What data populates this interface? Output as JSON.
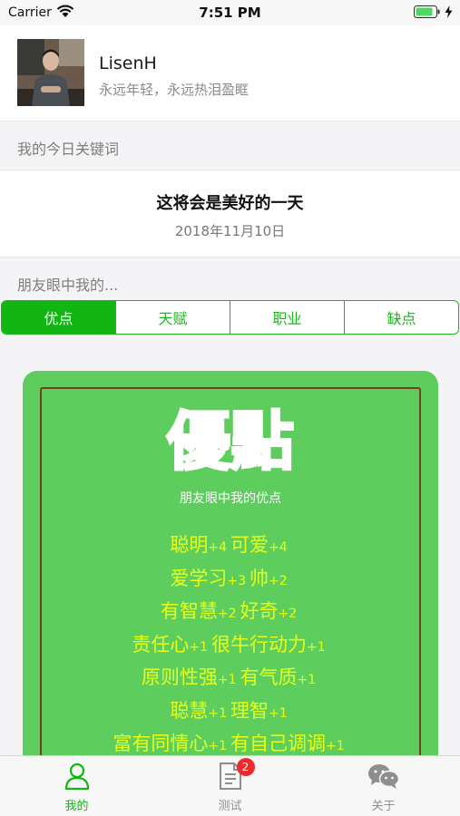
{
  "status_bar": {
    "carrier": "Carrier",
    "time": "7:51 PM"
  },
  "profile": {
    "name": "LisenH",
    "motto": "永远年轻，永远热泪盈眶"
  },
  "keyword_section": {
    "header": "我的今日关键词",
    "title": "这将会是美好的一天",
    "date": "2018年11月10日"
  },
  "friends_section": {
    "header": "朋友眼中我的..."
  },
  "tabs": [
    {
      "label": "优点",
      "active": true
    },
    {
      "label": "天赋",
      "active": false
    },
    {
      "label": "职业",
      "active": false
    },
    {
      "label": "缺点",
      "active": false
    }
  ],
  "card": {
    "logo_text": "優點",
    "subtitle": "朋友眼中我的优点",
    "lines": [
      [
        {
          "word": "聪明",
          "count": "+4"
        },
        {
          "word": "可爱",
          "count": "+4"
        }
      ],
      [
        {
          "word": "爱学习",
          "count": "+3"
        },
        {
          "word": "帅",
          "count": "+2"
        }
      ],
      [
        {
          "word": "有智慧",
          "count": "+2"
        },
        {
          "word": "好奇",
          "count": "+2"
        }
      ],
      [
        {
          "word": "责任心",
          "count": "+1"
        },
        {
          "word": "很牛行动力",
          "count": "+1"
        }
      ],
      [
        {
          "word": "原则性强",
          "count": "+1"
        },
        {
          "word": "有气质",
          "count": "+1"
        }
      ],
      [
        {
          "word": "聪慧",
          "count": "+1"
        },
        {
          "word": "理智",
          "count": "+1"
        }
      ],
      [
        {
          "word": "富有同情心",
          "count": "+1"
        },
        {
          "word": "有自己调调",
          "count": "+1"
        }
      ]
    ]
  },
  "tabbar": [
    {
      "label": "我的",
      "icon": "person-icon",
      "active": true
    },
    {
      "label": "测试",
      "icon": "document-icon",
      "active": false,
      "badge": "2"
    },
    {
      "label": "关于",
      "icon": "wechat-icon",
      "active": false
    }
  ],
  "colors": {
    "accent": "#12b612",
    "card": "#5dcd5e",
    "trait_text": "#e8ff1a",
    "badge": "#ee2b2b"
  }
}
